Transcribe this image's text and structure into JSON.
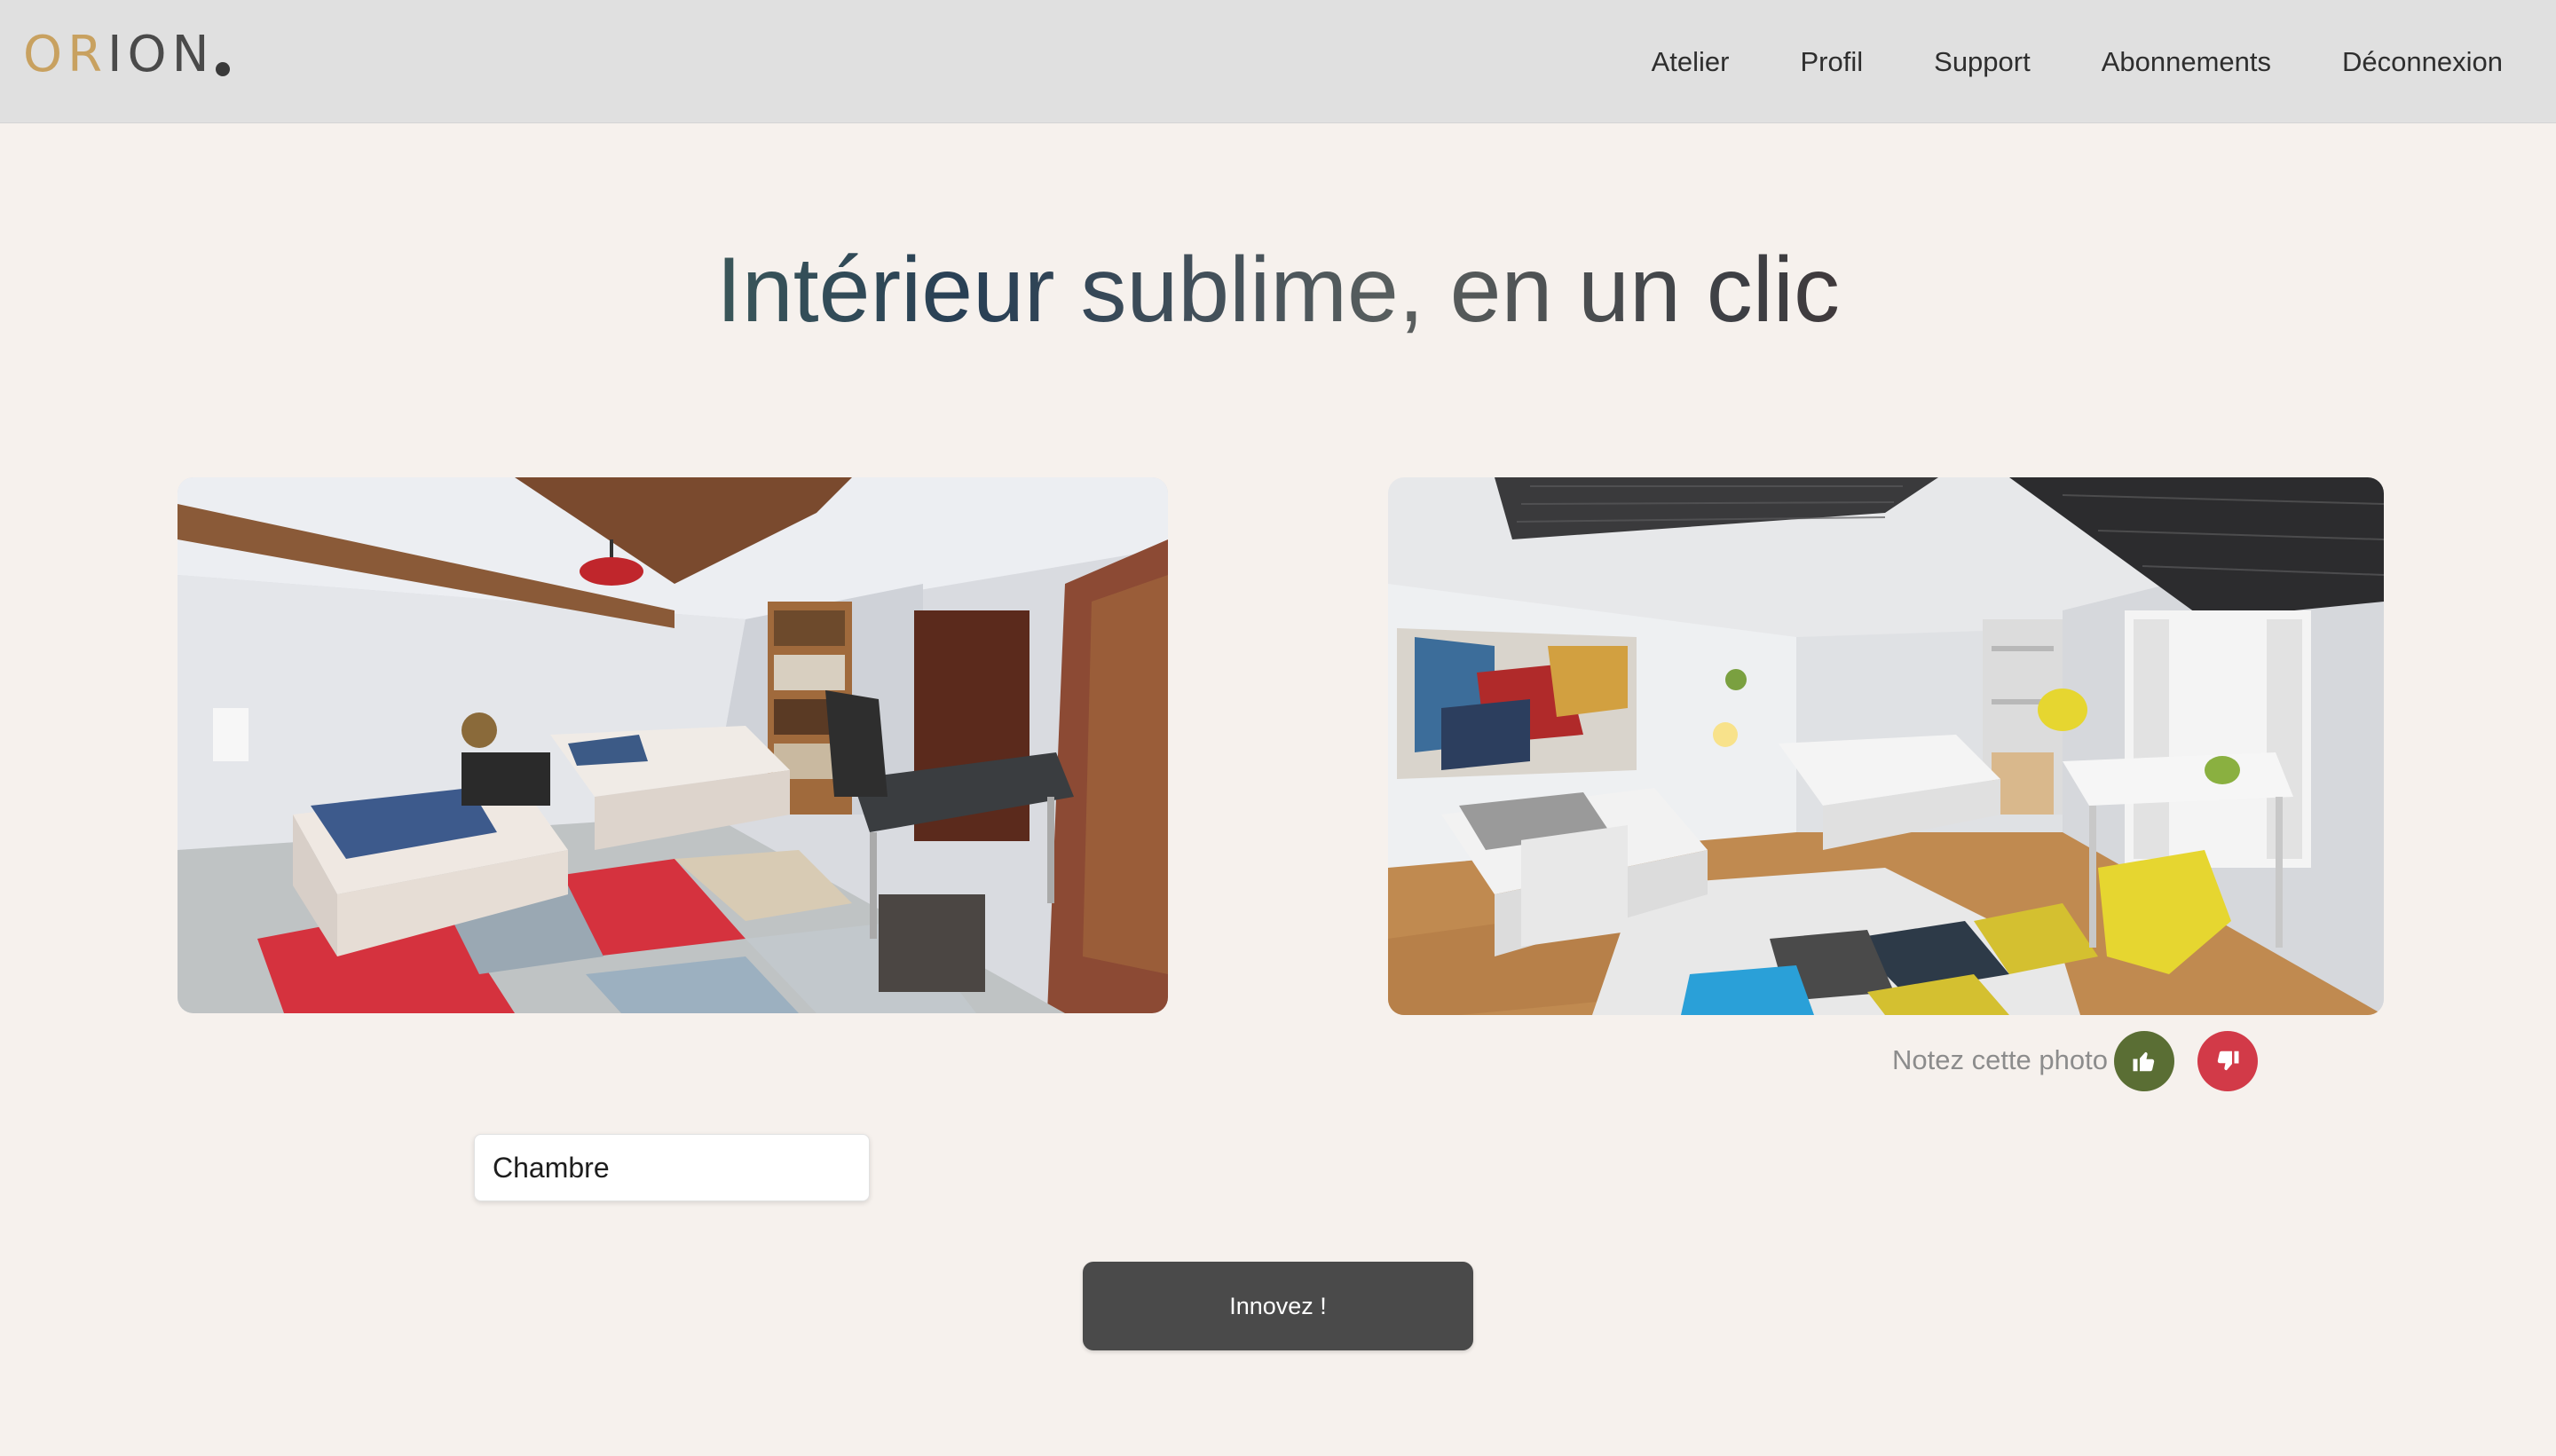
{
  "header": {
    "logo": {
      "part_gold": "OR",
      "part_dark": "ION"
    },
    "nav": [
      {
        "label": "Atelier"
      },
      {
        "label": "Profil"
      },
      {
        "label": "Support"
      },
      {
        "label": "Abonnements"
      },
      {
        "label": "Déconnexion"
      }
    ]
  },
  "hero": {
    "title": "Intérieur sublime, en un clic"
  },
  "rating": {
    "label": "Notez cette photo",
    "up_icon": "thumbs-up-icon",
    "down_icon": "thumbs-down-icon"
  },
  "form": {
    "room_value": "Chambre"
  },
  "cta": {
    "label": "Innovez !"
  },
  "colors": {
    "header_bg": "#e0e0e0",
    "page_bg": "#f6f1ed",
    "logo_gold": "#c8a160",
    "thumbs_up": "#5a6e34",
    "thumbs_down": "#d23a48",
    "button_bg": "#4a4a4a"
  }
}
